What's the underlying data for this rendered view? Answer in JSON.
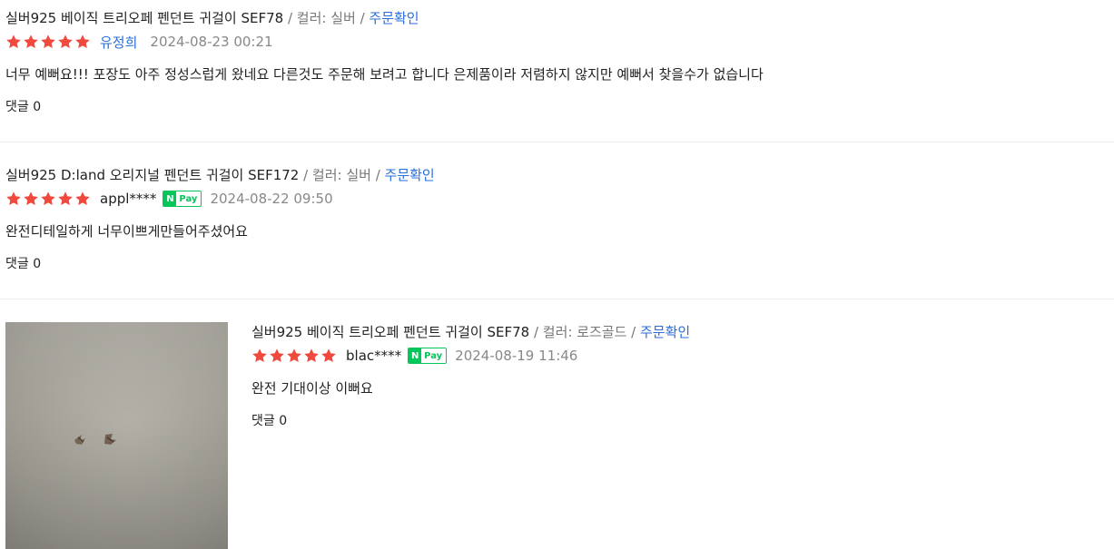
{
  "reviews": [
    {
      "product": "실버925 베이직 트리오페 펜던트 귀걸이 SEF78",
      "option": " / 컬러: 실버 / ",
      "order_label": "주문확인",
      "rating": 5,
      "author": "유정희",
      "npay": false,
      "date": "2024-08-23 00:21",
      "text": "너무 예뻐요!!! 포장도 아주 정성스럽게 왔네요 다른것도 주문해 보려고 합니다 은제품이라 저렴하지 않지만 예뻐서 찾을수가 없습니다",
      "comments": "댓글 0"
    },
    {
      "product": "실버925 D:land 오리지널 펜던트 귀걸이 SEF172",
      "option": " / 컬러: 실버 / ",
      "order_label": "주문확인",
      "rating": 5,
      "author": "appl****",
      "npay": true,
      "date": "2024-08-22 09:50",
      "text": "완전디테일하게 너무이쁘게만들어주셨어요",
      "comments": "댓글 0"
    },
    {
      "product": "실버925 베이직 트리오페 펜던트 귀걸이 SEF78",
      "option": " / 컬러: 로즈골드 / ",
      "order_label": "주문확인",
      "rating": 5,
      "author": "blac****",
      "npay": true,
      "date": "2024-08-19 11:46",
      "text": "완전 기대이상 이뻐요",
      "comments": "댓글 0"
    }
  ],
  "npay_badge": {
    "n": "N",
    "pay": "Pay"
  },
  "colors": {
    "star": "#f04a3e",
    "link": "#2a6edb",
    "npay": "#03c75a"
  },
  "icons": {
    "star": "star-icon",
    "photo": "review-photo"
  }
}
